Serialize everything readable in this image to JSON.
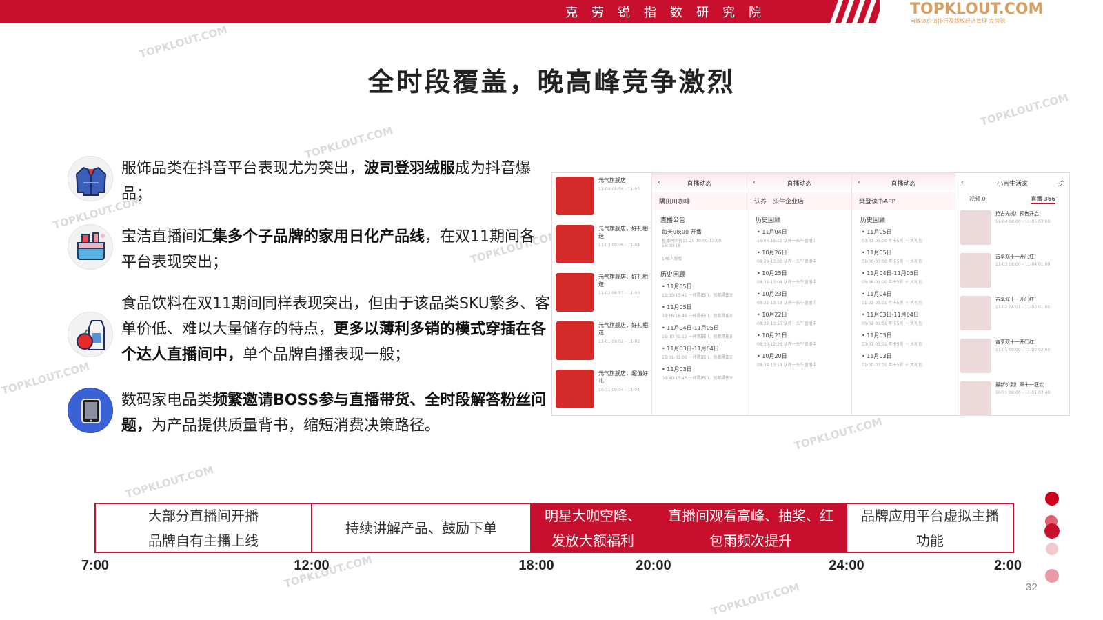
{
  "header": {
    "org_name": "克劳锐指数研究院",
    "logo_text": "TOPKLOUT.COM",
    "logo_tagline": "自媒体价值排行及版权经济管理",
    "logo_brand": "克劳锐",
    "accent_color": "#c8102e",
    "logo_color": "#d9a063"
  },
  "page": {
    "title": "全时段覆盖，晚高峰竞争激烈",
    "page_number": "32"
  },
  "watermark_text": "TOPKLOUT.COM",
  "bullets": [
    {
      "icon": "down-jacket-icon",
      "parts": [
        {
          "t": "服饰品类在抖音平台表现尤为突出，"
        },
        {
          "t": "波司登羽绒服",
          "b": true
        },
        {
          "t": "成为抖音爆品；"
        }
      ]
    },
    {
      "icon": "household-products-icon",
      "parts": [
        {
          "t": "宝洁直播间"
        },
        {
          "t": "汇集多个子品牌的家用日化产品线",
          "b": true
        },
        {
          "t": "，在双11期间各平台表现突出；"
        }
      ]
    },
    {
      "icon": "food-drink-icon",
      "parts": [
        {
          "t": "食品饮料在双11期间同样表现突出，但由于该品类SKU繁多、客单价低、难以大量储存的特点，"
        },
        {
          "t": "更多以薄利多销的模式穿插在各个达人直播间中，",
          "b": true
        },
        {
          "t": "单个品牌自播表现一般；"
        }
      ]
    },
    {
      "icon": "tablet-device-icon",
      "parts": [
        {
          "t": "数码家电品类"
        },
        {
          "t": "频繁邀请BOSS参与直播带货、全时段解答粉丝问题，",
          "b": true
        },
        {
          "t": "为产品提供质量背书，缩短消费决策路径。"
        }
      ]
    }
  ],
  "screenshots": {
    "panel1": {
      "cards": [
        {
          "shop": "元气旗舰店",
          "time": "11-04 08:58 - 11-05"
        },
        {
          "shop": "元气旗舰店，好礼相送",
          "time": "11-03 09:06 - 11-04"
        },
        {
          "shop": "元气旗舰店，好礼相送",
          "time": "11-02 08:57 - 11-03"
        },
        {
          "shop": "元气旗舰店，好礼相送",
          "time": "11-01 09:02 - 11-02"
        },
        {
          "shop": "元气旗舰店，超值好礼",
          "time": "10-31 09:04 - 11-01"
        }
      ]
    },
    "panel2": {
      "header": "直播动态",
      "shop": "隅田川咖啡",
      "notice_title": "直播公告",
      "notice_line1": "每天08:00 开播",
      "notice_line2": "直播时间有11-20 10:00-13:00, 16:00-18",
      "viewers": "148人想看",
      "history_title": "历史回顾",
      "rows": [
        {
          "date": "11月05日",
          "sub": "11:05-13:41 一杯隅田川，别都隅田川"
        },
        {
          "date": "11月05日",
          "sub": "08:16-16:46 一杯隅田川，别都隅田川"
        },
        {
          "date": "11月04日-11月05日",
          "sub": "15:00-01:12 一杯隅田川，别都隅田川"
        },
        {
          "date": "11月03日-11月04日",
          "sub": "15:01-01:00 一杯隅田川，别都隅田川"
        },
        {
          "date": "11月03日",
          "sub": "08:40-13:45 一杯隅田川，别都隅田川"
        }
      ]
    },
    "panel3": {
      "header": "直播动态",
      "shop": "认养一头牛企业店",
      "history_title": "历史回顾",
      "rows": [
        {
          "date": "11月04日",
          "sub": "15:06-15:12 认养一头牛直播中"
        },
        {
          "date": "10月26日",
          "sub": "08:29-13:00 认养一头牛直播中"
        },
        {
          "date": "10月25日",
          "sub": "08:31-13:04 认养一头牛直播中"
        },
        {
          "date": "10月23日",
          "sub": "08:32-13:18 认养一头牛直播中"
        },
        {
          "date": "10月22日",
          "sub": "08:32-13:15 认养一头牛直播中"
        },
        {
          "date": "10月21日",
          "sub": "08:30-12:26 认养一头牛直播中"
        },
        {
          "date": "10月20日",
          "sub": "08:34-13:14 认养一头牛直播中"
        }
      ]
    },
    "panel4": {
      "header": "直播动态",
      "shop": "樊登读书APP",
      "history_title": "历史回顾",
      "rows": [
        {
          "date": "11月05日",
          "sub": "03:01-05:00 年卡5折 ＋ 大礼包"
        },
        {
          "date": "11月05日",
          "sub": "01:00-03:00 年卡5折 ＋ 大礼包"
        },
        {
          "date": "11月04日-11月05日",
          "sub": "05:06-01:00 年卡5折 ＋ 大礼包"
        },
        {
          "date": "11月04日",
          "sub": "01:01-05:01 年卡5折 ＋ 大礼包"
        },
        {
          "date": "11月03日-11月04日",
          "sub": "05:02-01:01 年卡5折 ＋ 大礼包"
        },
        {
          "date": "11月03日",
          "sub": "03:07-05:01 年卡5折 ＋ 大礼包"
        },
        {
          "date": "11月03日",
          "sub": "01:00-03:01 年卡5折 ＋ 大礼包"
        }
      ]
    },
    "panel5": {
      "header": "小吉生活家",
      "tab_video": "视频 0",
      "tab_live": "直播 366",
      "cards": [
        {
          "title": "抢占先机！预售开启！",
          "time": "11-04 08:00 - 11-05 03:00"
        },
        {
          "title": "吉享双十一开门红！",
          "time": "11-03 08:00 - 11-04 01:00"
        },
        {
          "title": "吉享双十一开门红！",
          "time": "11-02 08:01 - 11-03 01:00"
        },
        {
          "title": "吉享双十一开门红！",
          "time": "11-01 09:00 - 11-02 02:00"
        },
        {
          "title": "最新价到！双十一狂欢",
          "time": "10-31 08:00 - 11-01 03:40"
        }
      ]
    }
  },
  "timeline": {
    "segments": [
      {
        "l1": "大部分直播间开播",
        "l2": "品牌自有主播上线",
        "style": "white"
      },
      {
        "l1": "持续讲解产品、鼓励下单",
        "l2": "",
        "style": "white"
      },
      {
        "l1": "明星大咖空降、",
        "l2": "发放大额福利",
        "style": "red"
      },
      {
        "l1": "直播间观看高峰、抽奖、红",
        "l2": "包雨频次提升",
        "style": "red"
      },
      {
        "l1": "品牌应用平台虚拟主播",
        "l2": "功能",
        "style": "white"
      }
    ],
    "ticks": [
      "7:00",
      "12:00",
      "18:00",
      "20:00",
      "24:00",
      "2:00"
    ]
  }
}
